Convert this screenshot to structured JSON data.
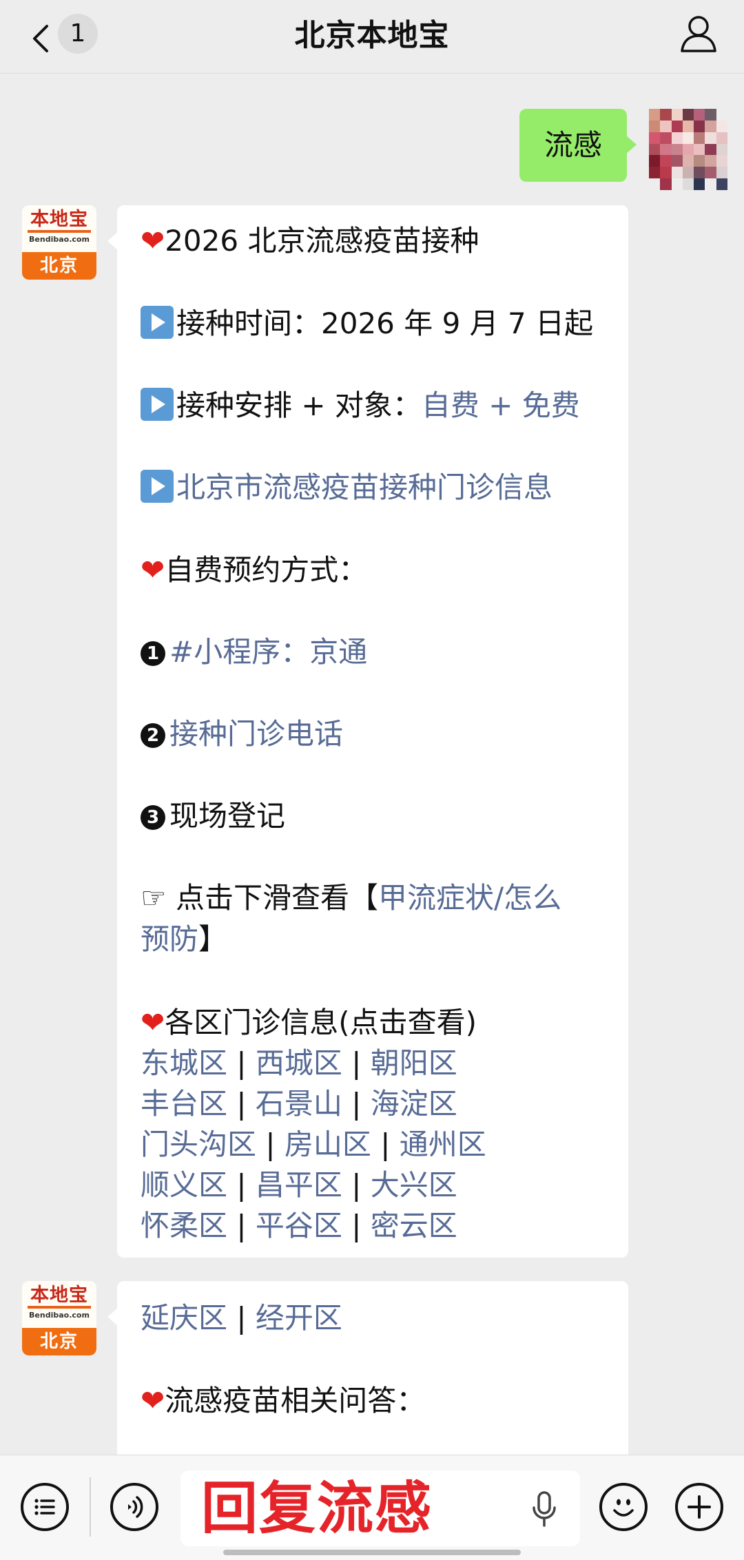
{
  "header": {
    "unread_count": "1",
    "title": "北京本地宝"
  },
  "outgoing": {
    "text": "流感"
  },
  "bot_avatar": {
    "brand": "本地宝",
    "domain": "Bendibao.com",
    "city": "北京"
  },
  "message1": {
    "line1": "2026 北京流感疫苗接种",
    "line2": "接种时间：2026 年 9 月 7 日起",
    "line3_label": "接种安排 + 对象：",
    "line3_link": "自费 + 免费",
    "line4_link": "北京市流感疫苗接种门诊信息",
    "line5": "自费预约方式：",
    "item1_num": "1",
    "item1_link": "#小程序：京通",
    "item2_num": "2",
    "item2_link": "接种门诊电话",
    "item3_num": "3",
    "item3_text": "现场登记",
    "scroll_prefix": "点击下滑查看【",
    "scroll_link_1": "甲流症状/怎么",
    "scroll_link_2": "预防",
    "scroll_suffix": "】",
    "districts_heading": "各区门诊信息(点击查看)",
    "district_rows": [
      [
        "东城区",
        "西城区",
        "朝阳区"
      ],
      [
        "丰台区",
        "石景山",
        "海淀区"
      ],
      [
        "门头沟区",
        "房山区",
        "通州区"
      ],
      [
        "顺义区",
        "昌平区",
        "大兴区"
      ],
      [
        "怀柔区",
        "平谷区",
        "密云区"
      ]
    ]
  },
  "message2": {
    "districts": [
      "延庆区",
      "经开区"
    ],
    "qa_heading": "流感疫苗相关问答："
  },
  "input": {
    "text": "回复流感"
  },
  "colors": {
    "link": "#576b95",
    "outgoing_bubble": "#95ec69",
    "background": "#ededed",
    "heart": "#e2211c",
    "brand_orange": "#f06e11"
  },
  "icons": [
    "back-chevron-icon",
    "profile-icon",
    "menu-list-icon",
    "voice-icon",
    "mic-icon",
    "emoji-icon",
    "plus-icon",
    "heart-icon",
    "play-icon",
    "pointing-hand-icon"
  ]
}
